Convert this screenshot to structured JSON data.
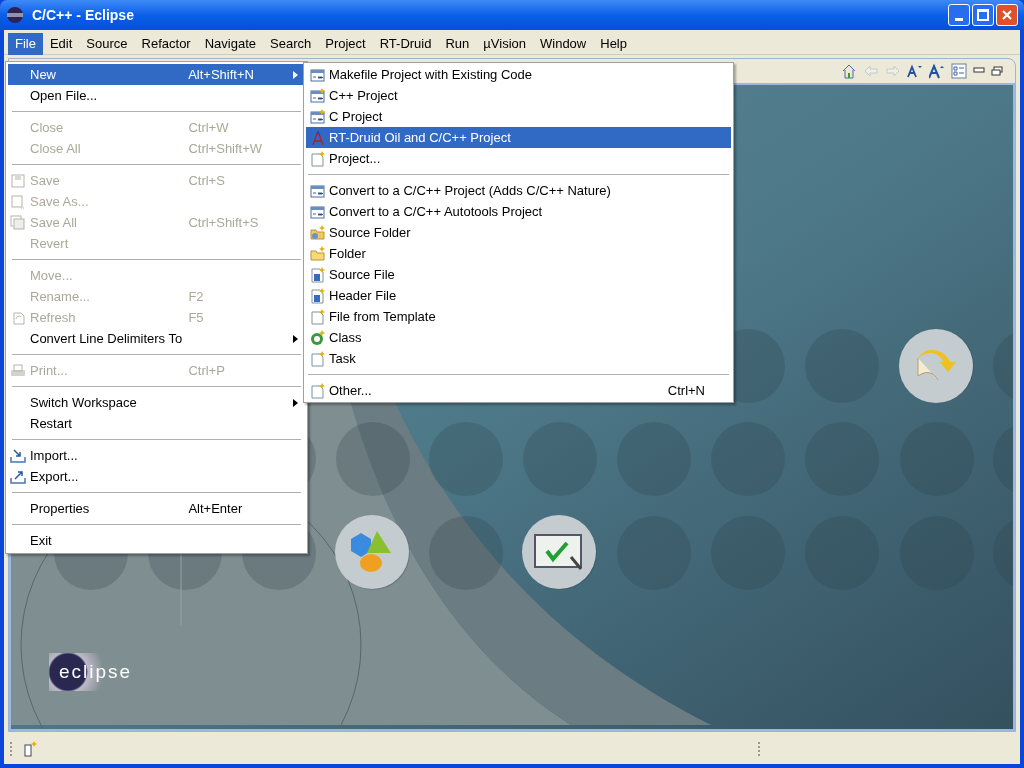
{
  "window": {
    "title": "C/C++ - Eclipse"
  },
  "menubar": [
    {
      "label": "File",
      "selected": true
    },
    {
      "label": "Edit",
      "selected": false
    },
    {
      "label": "Source",
      "selected": false
    },
    {
      "label": "Refactor",
      "selected": false
    },
    {
      "label": "Navigate",
      "selected": false
    },
    {
      "label": "Search",
      "selected": false
    },
    {
      "label": "Project",
      "selected": false
    },
    {
      "label": "RT-Druid",
      "selected": false
    },
    {
      "label": "Run",
      "selected": false
    },
    {
      "label": "µVision",
      "selected": false
    },
    {
      "label": "Window",
      "selected": false
    },
    {
      "label": "Help",
      "selected": false
    }
  ],
  "file_menu": [
    [
      {
        "label": "New",
        "shortcut": "Alt+Shift+N",
        "submenu": true,
        "disabled": false,
        "selected": true
      },
      {
        "label": "Open File...",
        "submenu": false,
        "disabled": false,
        "selected": false
      }
    ],
    [
      {
        "label": "Close",
        "shortcut": "Ctrl+W",
        "submenu": false,
        "disabled": true,
        "selected": false
      },
      {
        "label": "Close All",
        "shortcut": "Ctrl+Shift+W",
        "submenu": false,
        "disabled": true,
        "selected": false
      }
    ],
    [
      {
        "label": "Save",
        "shortcut": "Ctrl+S",
        "submenu": false,
        "disabled": true,
        "selected": false
      },
      {
        "label": "Save As...",
        "submenu": false,
        "disabled": true,
        "selected": false
      },
      {
        "label": "Save All",
        "shortcut": "Ctrl+Shift+S",
        "submenu": false,
        "disabled": true,
        "selected": false
      },
      {
        "label": "Revert",
        "submenu": false,
        "disabled": true,
        "selected": false
      }
    ],
    [
      {
        "label": "Move...",
        "submenu": false,
        "disabled": true,
        "selected": false
      },
      {
        "label": "Rename...",
        "shortcut": "F2",
        "submenu": false,
        "disabled": true,
        "selected": false
      },
      {
        "label": "Refresh",
        "shortcut": "F5",
        "submenu": false,
        "disabled": true,
        "selected": false
      },
      {
        "label": "Convert Line Delimiters To",
        "submenu": true,
        "disabled": false,
        "selected": false
      }
    ],
    [
      {
        "label": "Print...",
        "shortcut": "Ctrl+P",
        "submenu": false,
        "disabled": true,
        "selected": false
      }
    ],
    [
      {
        "label": "Switch Workspace",
        "submenu": true,
        "disabled": false,
        "selected": false
      },
      {
        "label": "Restart",
        "submenu": false,
        "disabled": false,
        "selected": false
      }
    ],
    [
      {
        "label": "Import...",
        "submenu": false,
        "disabled": false,
        "selected": false
      },
      {
        "label": "Export...",
        "submenu": false,
        "disabled": false,
        "selected": false
      }
    ],
    [
      {
        "label": "Properties",
        "shortcut": "Alt+Enter",
        "submenu": false,
        "disabled": false,
        "selected": false
      }
    ],
    [
      {
        "label": "Exit",
        "submenu": false,
        "disabled": false,
        "selected": false
      }
    ]
  ],
  "new_submenu": [
    [
      {
        "label": "Makefile Project with Existing Code",
        "selected": false
      },
      {
        "label": "C++ Project",
        "selected": false
      },
      {
        "label": "C Project",
        "selected": false
      },
      {
        "label": "RT-Druid Oil and C/C++ Project",
        "selected": true
      },
      {
        "label": "Project...",
        "selected": false
      }
    ],
    [
      {
        "label": "Convert to a C/C++ Project (Adds C/C++ Nature)",
        "selected": false
      },
      {
        "label": "Convert to a C/C++ Autotools Project",
        "selected": false
      },
      {
        "label": "Source Folder",
        "selected": false
      },
      {
        "label": "Folder",
        "selected": false
      },
      {
        "label": "Source File",
        "selected": false
      },
      {
        "label": "Header File",
        "selected": false
      },
      {
        "label": "File from Template",
        "selected": false
      },
      {
        "label": "Class",
        "selected": false
      },
      {
        "label": "Task",
        "selected": false
      }
    ],
    [
      {
        "label": "Other...",
        "shortcut": "Ctrl+N",
        "selected": false
      }
    ]
  ],
  "welcome": {
    "logo_text": "eclipse"
  }
}
